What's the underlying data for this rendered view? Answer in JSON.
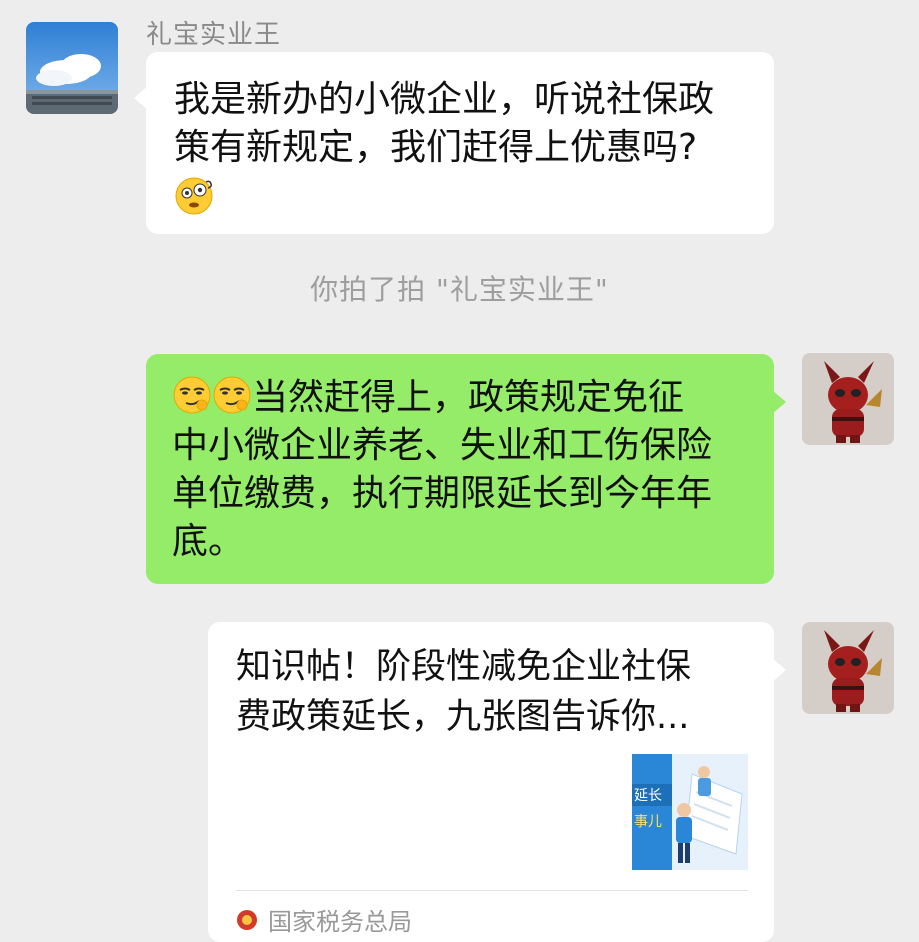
{
  "chat": {
    "sender_name": "礼宝实业王",
    "incoming_message": {
      "line1": "我是新办的小微企业，听说社保政",
      "line2": "策有新规定，我们赶得上优惠吗?",
      "emoji": "thinking-face-emoji"
    },
    "system_message": "你拍了拍 \"礼宝实业王\"",
    "outgoing_message": {
      "emojis": [
        "smirk-face-emoji",
        "smirk-face-emoji"
      ],
      "line1": "当然赶得上，政策规定免征",
      "line2": "中小微企业养老、失业和工伤保险",
      "line3": "单位缴费，执行期限延长到今年年",
      "line4": "底。"
    },
    "shared_article": {
      "title_line1": "知识帖！阶段性减免企业社保",
      "title_line2": "费政策延长，九张图告诉你...",
      "thumbnail_text1": "延长",
      "thumbnail_text2": "事儿",
      "source": "国家税务总局"
    }
  },
  "colors": {
    "background": "#ededed",
    "incoming_bubble": "#ffffff",
    "outgoing_bubble": "#95ec69",
    "name_text": "#8a8a8a",
    "system_text": "#9e9e9e"
  }
}
